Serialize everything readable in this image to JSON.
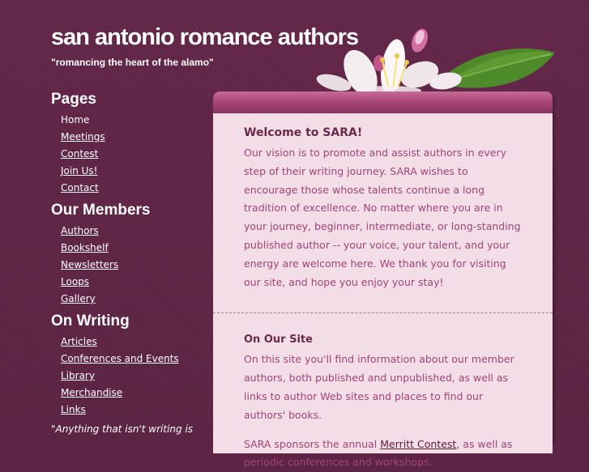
{
  "header": {
    "title": "san antonio romance authors",
    "tagline": "\"romancing the heart of the alamo\""
  },
  "sidebar": {
    "groups": [
      {
        "title": "Pages",
        "items": [
          "Home",
          "Meetings",
          "Contest",
          "Join Us!",
          "Contact"
        ]
      },
      {
        "title": "Our Members",
        "items": [
          "Authors",
          "Bookshelf",
          "Newsletters",
          "Loops",
          "Gallery"
        ]
      },
      {
        "title": "On Writing",
        "items": [
          "Articles",
          "Conferences and Events",
          "Library",
          "Merchandise",
          "Links"
        ]
      }
    ],
    "quote": "\"Anything that isn't writing is"
  },
  "main": {
    "welcome": {
      "heading": "Welcome to SARA!",
      "body": "Our vision is to promote and assist authors in every step of their writing journey. SARA wishes to encourage those whose talents continue a long tradition of excellence. No matter where you are in your journey, beginner, intermediate, or long-standing published author -- your voice, your talent, and your energy are welcome here. We thank you for visiting our site, and hope you enjoy your stay!"
    },
    "onsite": {
      "heading": "On Our Site",
      "para1": "On this site you'll find information about our member authors, both published and unpublished, as well as links to author Web sites and places to find our authors' books.",
      "para2_before": "SARA sponsors the annual ",
      "para2_link": "Merritt Contest",
      "para2_after": ", as well as periodic conferences and workshops."
    }
  },
  "colors": {
    "background": "#5e2445",
    "content_bg": "#f3dde7",
    "text_body": "#a0447a",
    "heading": "#6b2a4c"
  }
}
